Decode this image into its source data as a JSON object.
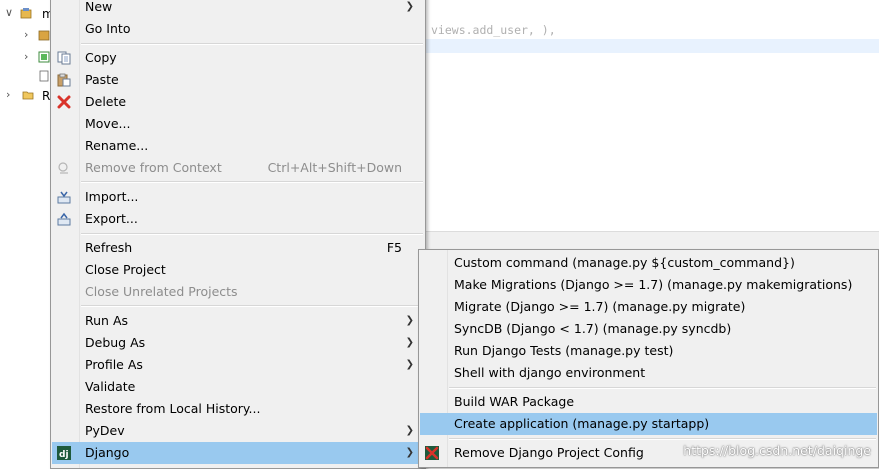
{
  "tree": {
    "rows": [
      {
        "label": "m"
      },
      {
        "label": ""
      },
      {
        "label": ""
      },
      {
        "label": ""
      },
      {
        "label": "R"
      }
    ]
  },
  "editor": {
    "code_line": "views.add_user, ),"
  },
  "context_menu": {
    "items": [
      {
        "label": "New",
        "shortcut": "",
        "submenu": true,
        "disabled": false
      },
      {
        "label": "Go Into",
        "shortcut": "",
        "submenu": false,
        "disabled": false
      },
      {
        "label": "Copy",
        "shortcut": "",
        "submenu": false,
        "disabled": false,
        "icon": "copy-icon"
      },
      {
        "label": "Paste",
        "shortcut": "",
        "submenu": false,
        "disabled": false,
        "icon": "paste-icon"
      },
      {
        "label": "Delete",
        "shortcut": "",
        "submenu": false,
        "disabled": false,
        "icon": "delete-icon"
      },
      {
        "label": "Move...",
        "shortcut": "",
        "submenu": false,
        "disabled": false
      },
      {
        "label": "Rename...",
        "shortcut": "",
        "submenu": false,
        "disabled": false
      },
      {
        "label": "Remove from Context",
        "shortcut": "Ctrl+Alt+Shift+Down",
        "submenu": false,
        "disabled": true,
        "icon": "remove-context-icon"
      },
      {
        "label": "Import...",
        "shortcut": "",
        "submenu": false,
        "disabled": false,
        "icon": "import-icon"
      },
      {
        "label": "Export...",
        "shortcut": "",
        "submenu": false,
        "disabled": false,
        "icon": "export-icon"
      },
      {
        "label": "Refresh",
        "shortcut": "F5",
        "submenu": false,
        "disabled": false
      },
      {
        "label": "Close Project",
        "shortcut": "",
        "submenu": false,
        "disabled": false
      },
      {
        "label": "Close Unrelated Projects",
        "shortcut": "",
        "submenu": false,
        "disabled": true
      },
      {
        "label": "Run As",
        "shortcut": "",
        "submenu": true,
        "disabled": false
      },
      {
        "label": "Debug As",
        "shortcut": "",
        "submenu": true,
        "disabled": false
      },
      {
        "label": "Profile As",
        "shortcut": "",
        "submenu": true,
        "disabled": false
      },
      {
        "label": "Validate",
        "shortcut": "",
        "submenu": false,
        "disabled": false
      },
      {
        "label": "Restore from Local History...",
        "shortcut": "",
        "submenu": false,
        "disabled": false
      },
      {
        "label": "PyDev",
        "shortcut": "",
        "submenu": true,
        "disabled": false
      },
      {
        "label": "Django",
        "shortcut": "",
        "submenu": true,
        "disabled": false,
        "icon": "django-icon",
        "selected": true
      }
    ]
  },
  "django_menu": {
    "items": [
      {
        "label": "Custom command (manage.py ${custom_command})"
      },
      {
        "label": "Make Migrations (Django >= 1.7) (manage.py makemigrations)"
      },
      {
        "label": "Migrate (Django >= 1.7) (manage.py migrate)"
      },
      {
        "label": "SyncDB (Django < 1.7) (manage.py syncdb)"
      },
      {
        "label": "Run Django Tests (manage.py test)"
      },
      {
        "label": "Shell with django environment"
      },
      {
        "label": "Build WAR Package"
      },
      {
        "label": "Create application (manage.py startapp)",
        "selected": true
      },
      {
        "label": "Remove Django Project Config",
        "icon": "remove-config-icon"
      }
    ]
  },
  "watermark": "https://blog.csdn.net/daiqinge",
  "colors": {
    "menu_bg": "#f0f0f0",
    "selection": "#99c9ef",
    "disabled_text": "#8d8d8d",
    "editor_highlight": "#e8f2fe"
  }
}
